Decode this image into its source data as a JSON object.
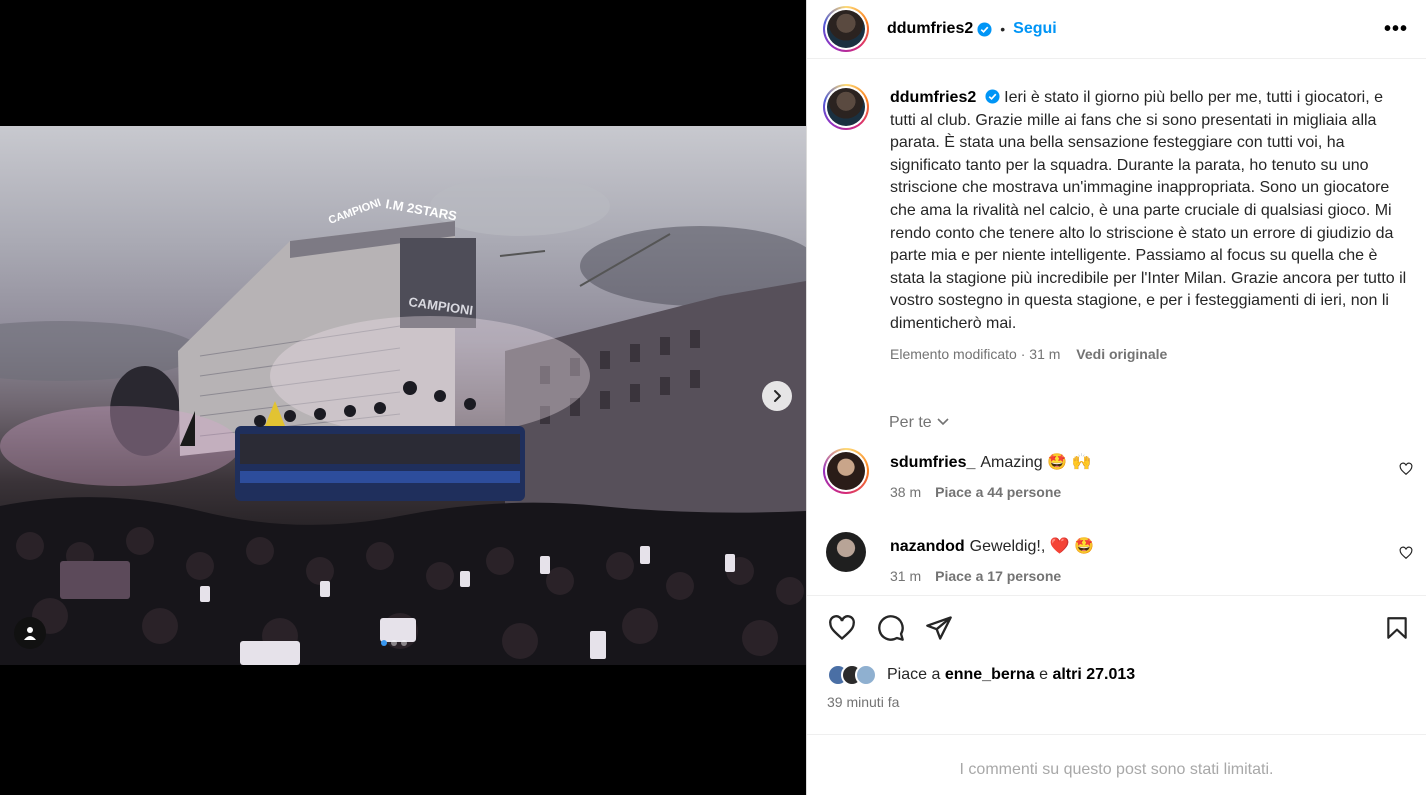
{
  "post": {
    "author": "ddumfries2",
    "follow_label": "Segui",
    "separator": "•",
    "more_label": "•••",
    "caption": "Ieri è stato il giorno più bello per me, tutti i giocatori, e tutti al club. Grazie mille ai fans che si sono presentati in migliaia alla parata. È stata una bella sensazione festeggiare con tutti voi, ha significato tanto per la squadra. Durante la parata, ho tenuto su uno striscione che mostrava un'immagine inappropriata. Sono un giocatore che ama la rivalità nel calcio, è una parte cruciale di qualsiasi gioco. Mi rendo conto che tenere alto lo striscione è stato un errore di giudizio da parte mia e per niente intelligente. Passiamo al focus su quella che è stata la stagione più incredibile per l'Inter Milan. Grazie ancora per tutto il vostro sostegno in questa stagione, e per i festeggiamenti di ieri, non li dimenticherò mai.",
    "edited_meta": "Elemento modificato · 31 m",
    "view_original": "Vedi originale",
    "for_you": "Per te",
    "media": {
      "building_sign_1": "I.M 2STARS",
      "building_sign_2": "CAMPIONI",
      "building_sign_3": "CAMPIONI",
      "carousel_count": 3,
      "carousel_active": 0
    }
  },
  "comments": [
    {
      "user": "sdumfries_",
      "text": "Amazing 🤩 🙌",
      "time": "38 m",
      "likes": "Piace a 44 persone"
    },
    {
      "user": "nazandod",
      "text": "Geweldig!, ❤️ 🤩",
      "time": "31 m",
      "likes": "Piace a 17 persone"
    }
  ],
  "likes": {
    "prefix": "Piace a",
    "user": "enne_berna",
    "conjunction": "e",
    "others": "altri 27.013"
  },
  "time_ago": "39 minuti fa",
  "comments_limited": "I commenti su questo post sono stati limitati.",
  "colors": {
    "accent": "#0095f6",
    "secondary_text": "#737373",
    "verified": "#0095f6"
  }
}
